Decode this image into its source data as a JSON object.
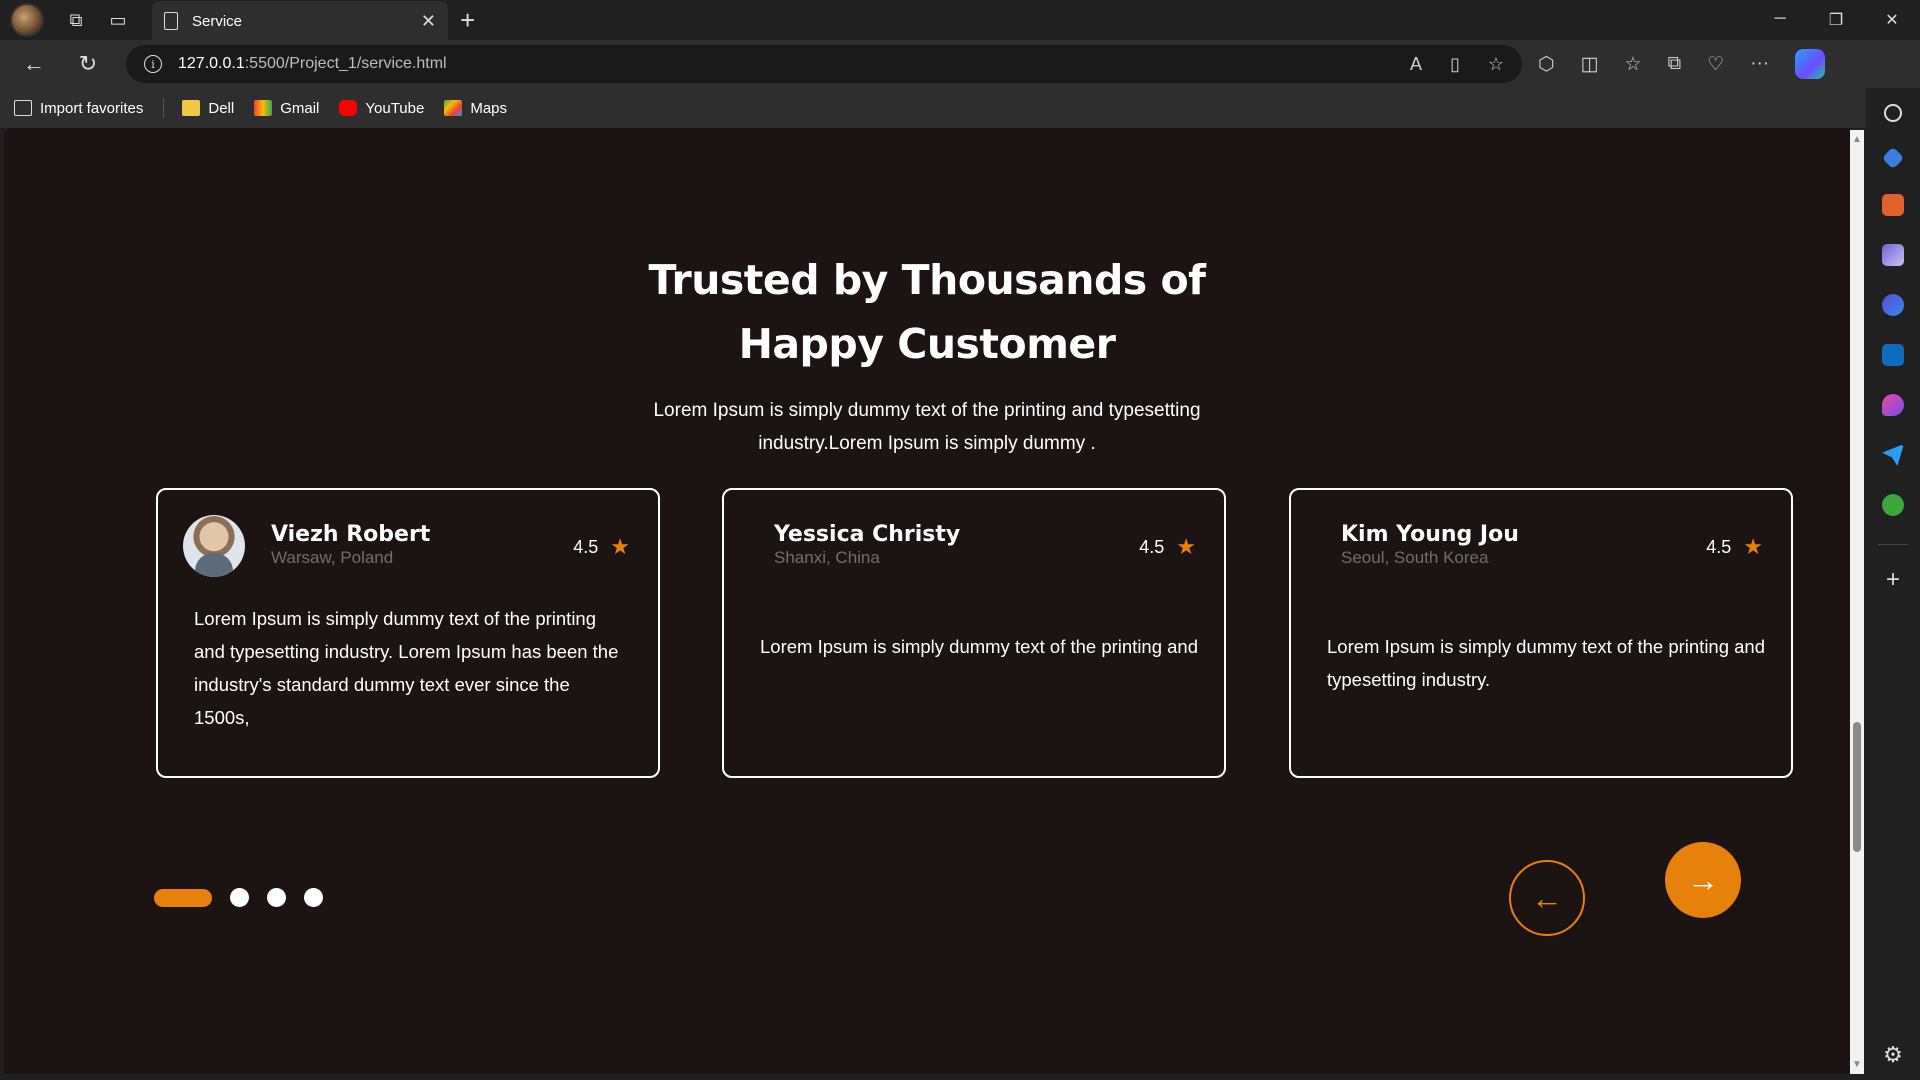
{
  "browser": {
    "tab_title": "Service",
    "url_host": "127.0.0.1",
    "url_path": ":5500/Project_1/service.html",
    "bookmarks": {
      "import": "Import favorites",
      "dell": "Dell",
      "gmail": "Gmail",
      "youtube": "YouTube",
      "maps": "Maps"
    },
    "icons": {
      "back": "←",
      "refresh": "↻",
      "new_tab": "+",
      "close": "✕",
      "minimize": "─",
      "restore": "❐",
      "window_close": "✕"
    }
  },
  "page": {
    "heading_line1": "Trusted by Thousands of",
    "heading_line2": "Happy Customer",
    "subtext": "Lorem Ipsum is simply dummy text of the printing and typesetting industry.Lorem Ipsum is simply dummy .",
    "accent_color": "#e8800c",
    "background_color": "#1c1412",
    "testimonials": [
      {
        "name": "Viezh Robert",
        "location": "Warsaw, Poland",
        "rating": "4.5",
        "review": "Lorem Ipsum is simply dummy text of the printing and typesetting industry. Lorem Ipsum has been the industry's standard dummy text ever since the 1500s,"
      },
      {
        "name": "Yessica Christy",
        "location": "Shanxi, China",
        "rating": "4.5",
        "review": "Lorem Ipsum is simply dummy text of the printing and"
      },
      {
        "name": "Kim Young Jou",
        "location": "Seoul, South Korea",
        "rating": "4.5",
        "review": "Lorem Ipsum is simply dummy text of the printing and typesetting industry."
      }
    ],
    "carousel": {
      "active_index": 1,
      "total": 4,
      "prev_arrow": "←",
      "next_arrow": "→",
      "star": "★"
    }
  }
}
